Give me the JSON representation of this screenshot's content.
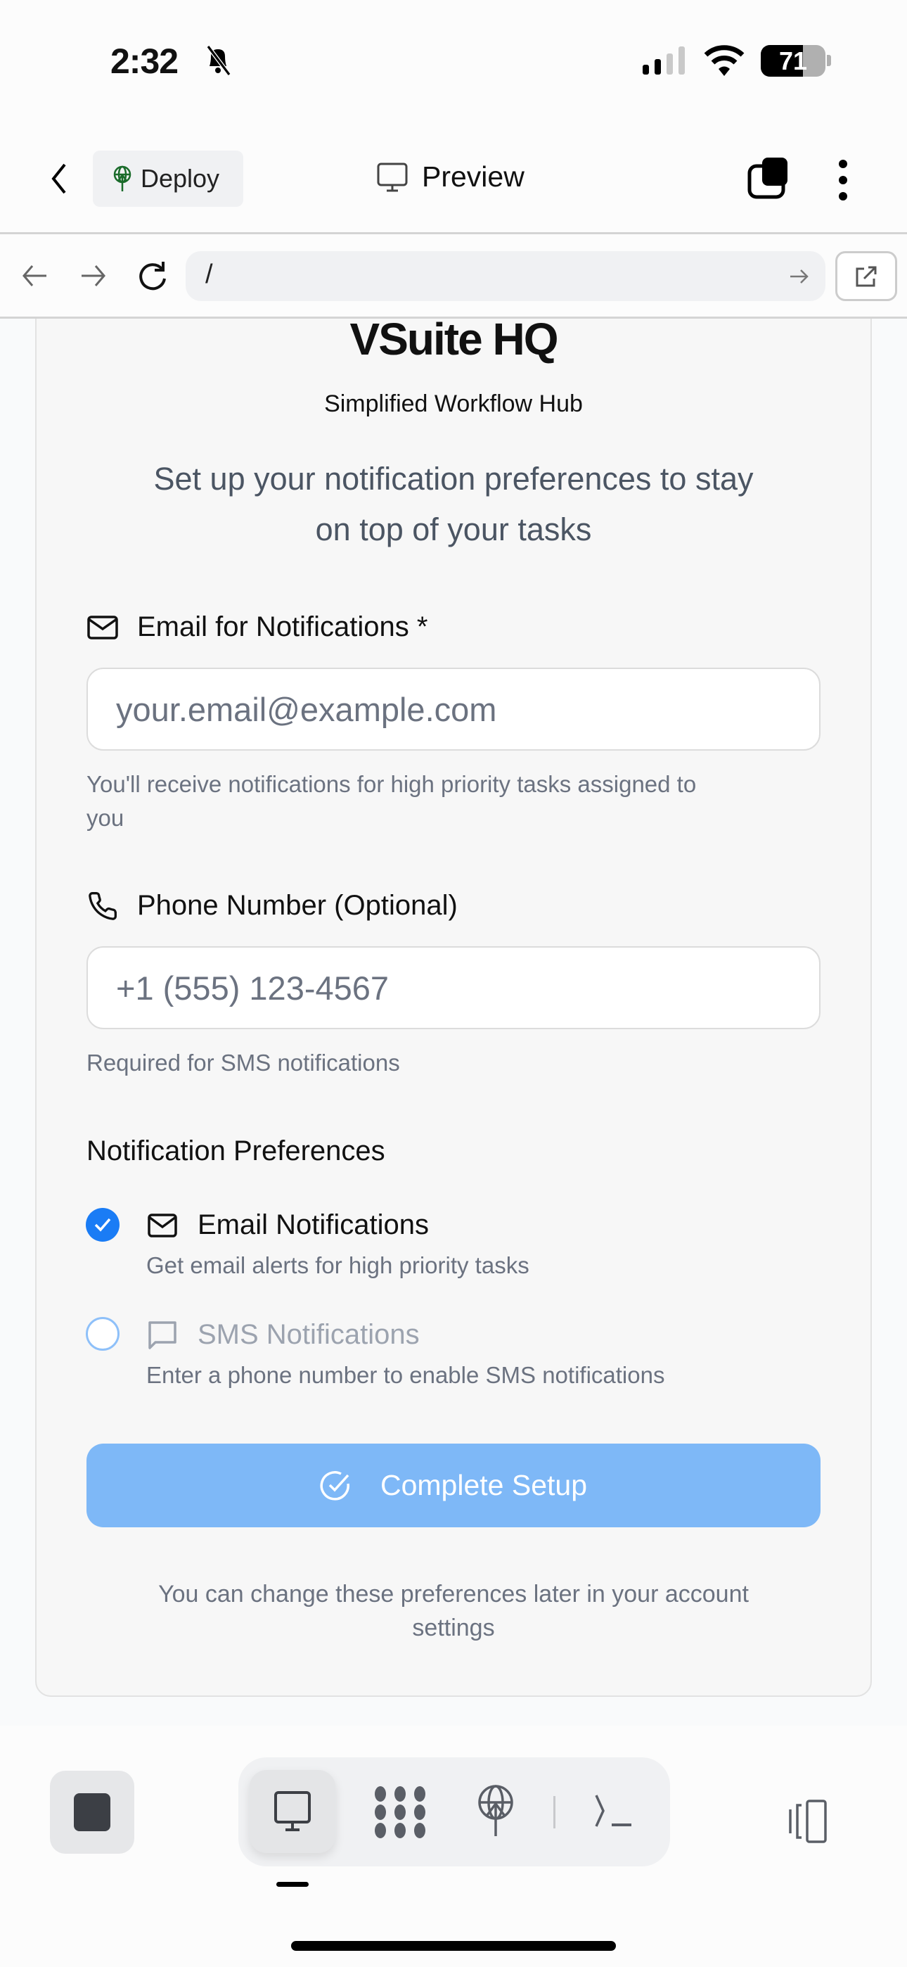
{
  "status_bar": {
    "time": "2:32",
    "battery": "71"
  },
  "header": {
    "deploy_label": "Deploy",
    "title": "Preview"
  },
  "browser": {
    "url": "/"
  },
  "app": {
    "brand": "VSuite HQ",
    "tagline": "Simplified Workflow Hub",
    "intro_line1": "Set up your notification preferences to stay",
    "intro_line2": "on top of your tasks",
    "email": {
      "label": "Email for Notifications *",
      "placeholder": "your.email@example.com",
      "help_line1": "You'll receive notifications for high priority tasks assigned to",
      "help_line2": "you"
    },
    "phone": {
      "label": "Phone Number (Optional)",
      "placeholder": "+1 (555) 123-4567",
      "help": "Required for SMS notifications"
    },
    "prefs": {
      "heading": "Notification Preferences",
      "email": {
        "label": "Email Notifications",
        "desc": "Get email alerts for high priority tasks",
        "checked": true
      },
      "sms": {
        "label": "SMS Notifications",
        "desc": "Enter a phone number to enable SMS notifications",
        "checked": false
      }
    },
    "submit_label": "Complete Setup",
    "footer_line1": "You can change these preferences later in your account",
    "footer_line2": "settings"
  },
  "colors": {
    "accent": "#1a7cf5",
    "button_disabled": "#7eb8f7",
    "deploy_icon": "#1a6b2a"
  }
}
